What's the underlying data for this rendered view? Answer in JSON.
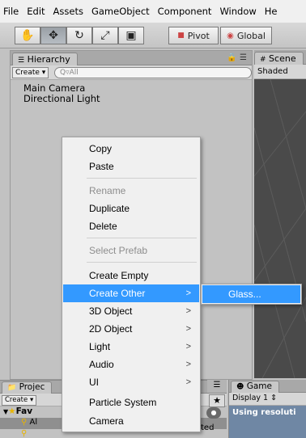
{
  "menubar": [
    "File",
    "Edit",
    "Assets",
    "GameObject",
    "Component",
    "Window",
    "He"
  ],
  "toolbar": {
    "hand_icon": "hand-icon",
    "move_icon": "move-icon",
    "rotate_icon": "rotate-icon",
    "scale_icon": "scale-icon",
    "rect_icon": "rect-tool-icon",
    "pivot": "Pivot",
    "global": "Global"
  },
  "hierarchy": {
    "tab": "Hierarchy",
    "create": "Create",
    "search": "Q▿All",
    "objects": [
      "Main Camera",
      "Directional Light"
    ]
  },
  "scene": {
    "tab": "Scene",
    "shading": "Shaded"
  },
  "project": {
    "tab": "Projec",
    "create": "Create",
    "favorites": "Fav",
    "row_prefix": "Al",
    "side_text": "ted"
  },
  "game": {
    "tab": "Game",
    "display": "Display 1",
    "message": "Using resoluti"
  },
  "context_menu": {
    "items": [
      {
        "label": "Copy",
        "enabled": true,
        "submenu": false
      },
      {
        "label": "Paste",
        "enabled": true,
        "submenu": false
      },
      {
        "label": "Rename",
        "enabled": false,
        "submenu": false
      },
      {
        "label": "Duplicate",
        "enabled": true,
        "submenu": false
      },
      {
        "label": "Delete",
        "enabled": true,
        "submenu": false
      },
      {
        "label": "Select Prefab",
        "enabled": false,
        "submenu": false
      },
      {
        "label": "Create Empty",
        "enabled": true,
        "submenu": false
      },
      {
        "label": "Create Other",
        "enabled": true,
        "submenu": true,
        "highlighted": true
      },
      {
        "label": "3D Object",
        "enabled": true,
        "submenu": true
      },
      {
        "label": "2D Object",
        "enabled": true,
        "submenu": true
      },
      {
        "label": "Light",
        "enabled": true,
        "submenu": true
      },
      {
        "label": "Audio",
        "enabled": true,
        "submenu": true
      },
      {
        "label": "UI",
        "enabled": true,
        "submenu": true
      },
      {
        "label": "Particle System",
        "enabled": true,
        "submenu": false
      },
      {
        "label": "Camera",
        "enabled": true,
        "submenu": false
      }
    ],
    "submenu_items": [
      {
        "label": "Glass...",
        "highlighted": true
      }
    ]
  },
  "colors": {
    "highlight": "#3399ff",
    "menu_bg": "#f0f0f0",
    "editor_bg": "#c2c2c2",
    "scene_bg": "#4a4a4a"
  }
}
